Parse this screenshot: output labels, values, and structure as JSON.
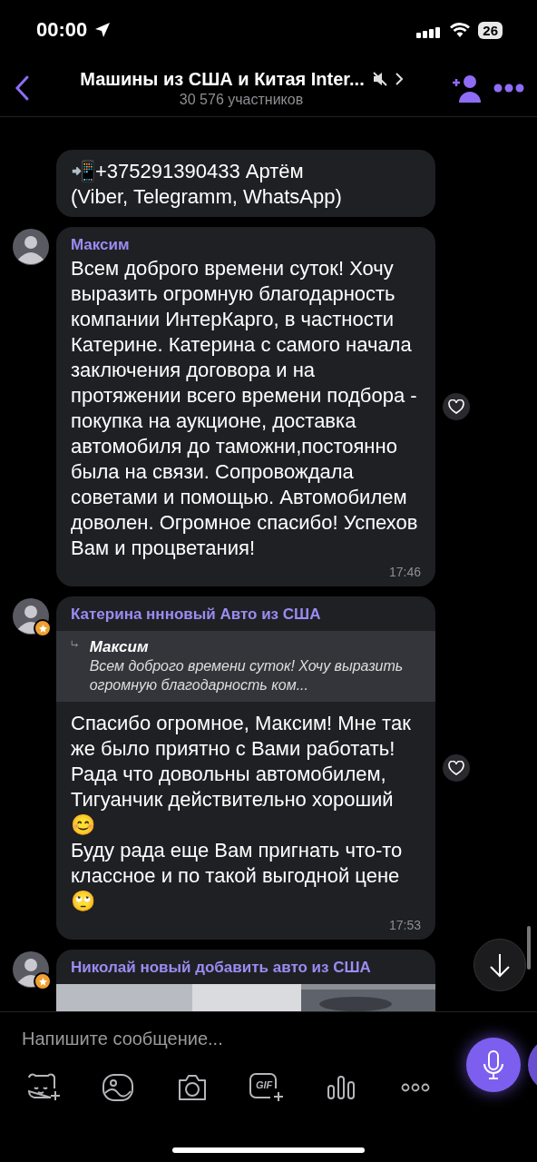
{
  "status_bar": {
    "time": "00:00",
    "battery": "26"
  },
  "header": {
    "title": "Машины из США и Китая Inter...",
    "subtitle": "30 576 участников",
    "muted": true
  },
  "messages": [
    {
      "kind": "text",
      "text": "📲+375291390433 Артём\n(Viber, Telegramm, WhatsApp)"
    },
    {
      "kind": "text",
      "sender": "Максим",
      "admin": false,
      "text": "Всем доброго времени суток! Хочу выразить огромную благодарность компании ИнтерКарго, в частности Катерине.  Катерина  с самого начала заключения договора и на протяжении всего времени подбора - покупка на аукционе, доставка автомобиля до таможни,постоянно была на связи. Сопровождала советами и помощью. Автомобилем доволен. Огромное спасибо!  Успехов Вам и процветания!",
      "time": "17:46"
    },
    {
      "kind": "text",
      "sender": "Катерина ннновый Авто из США",
      "admin": true,
      "reply": {
        "sender": "Максим",
        "text": "Всем доброго времени суток! Хочу выразить огромную благодарность ком..."
      },
      "text": "Спасибо огромное, Максим! Мне так же было приятно с Вами работать! Рада что довольны автомобилем, Тигуанчик действительно хороший 😊\nБуду рада еще Вам пригнать что-то классное и по такой выгодной цене 🙄",
      "time": "17:53"
    },
    {
      "sender": "Николай новый добавить авто из США",
      "admin": true
    }
  ],
  "composer": {
    "placeholder": "Напишите сообщение...",
    "gif_label": "GIF"
  }
}
